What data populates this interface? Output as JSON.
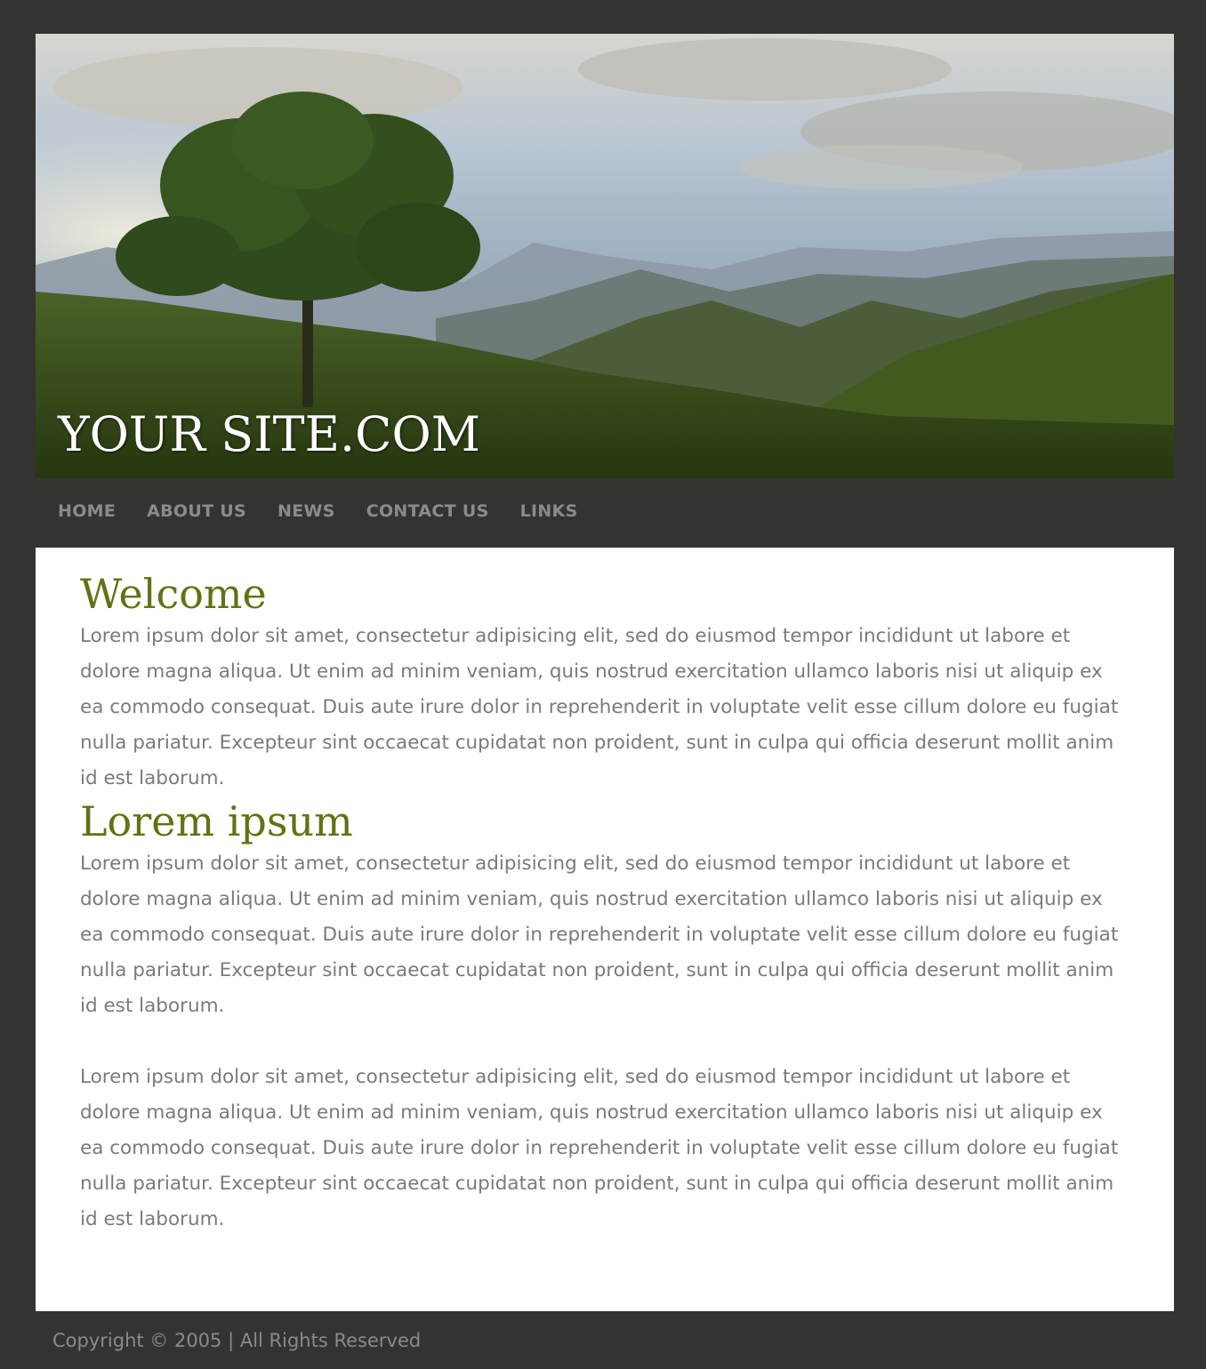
{
  "header": {
    "site_title": "YOUR SITE.COM"
  },
  "nav": {
    "items": [
      {
        "label": "HOME"
      },
      {
        "label": "ABOUT US"
      },
      {
        "label": "NEWS"
      },
      {
        "label": "CONTACT US"
      },
      {
        "label": "LINKS"
      }
    ]
  },
  "main": {
    "sections": [
      {
        "heading": "Welcome",
        "paragraphs": [
          "Lorem ipsum dolor sit amet, consectetur adipisicing elit, sed do eiusmod tempor incididunt ut labore et dolore magna aliqua. Ut enim ad minim veniam, quis nostrud exercitation ullamco laboris nisi ut aliquip ex ea commodo consequat. Duis aute irure dolor in reprehenderit in voluptate velit esse cillum dolore eu fugiat nulla pariatur. Excepteur sint occaecat cupidatat non proident, sunt in culpa qui officia deserunt mollit anim id est laborum."
        ]
      },
      {
        "heading": "Lorem ipsum",
        "paragraphs": [
          "Lorem ipsum dolor sit amet, consectetur adipisicing elit, sed do eiusmod tempor incididunt ut labore et dolore magna aliqua. Ut enim ad minim veniam, quis nostrud exercitation ullamco laboris nisi ut aliquip ex ea commodo consequat. Duis aute irure dolor in reprehenderit in voluptate velit esse cillum dolore eu fugiat nulla pariatur. Excepteur sint occaecat cupidatat non proident, sunt in culpa qui officia deserunt mollit anim id est laborum.",
          "Lorem ipsum dolor sit amet, consectetur adipisicing elit, sed do eiusmod tempor incididunt ut labore et dolore magna aliqua. Ut enim ad minim veniam, quis nostrud exercitation ullamco laboris nisi ut aliquip ex ea commodo consequat. Duis aute irure dolor in reprehenderit in voluptate velit esse cillum dolore eu fugiat nulla pariatur. Excepteur sint occaecat cupidatat non proident, sunt in culpa qui officia deserunt mollit anim id est laborum."
        ]
      }
    ]
  },
  "footer": {
    "copyright": "Copyright © 2005 | All Rights Reserved"
  },
  "colors": {
    "page_background": "#333331",
    "heading": "#5e7413",
    "body_text": "#7a7a78",
    "nav_text": "#8b8b89",
    "content_background": "#ffffff"
  }
}
